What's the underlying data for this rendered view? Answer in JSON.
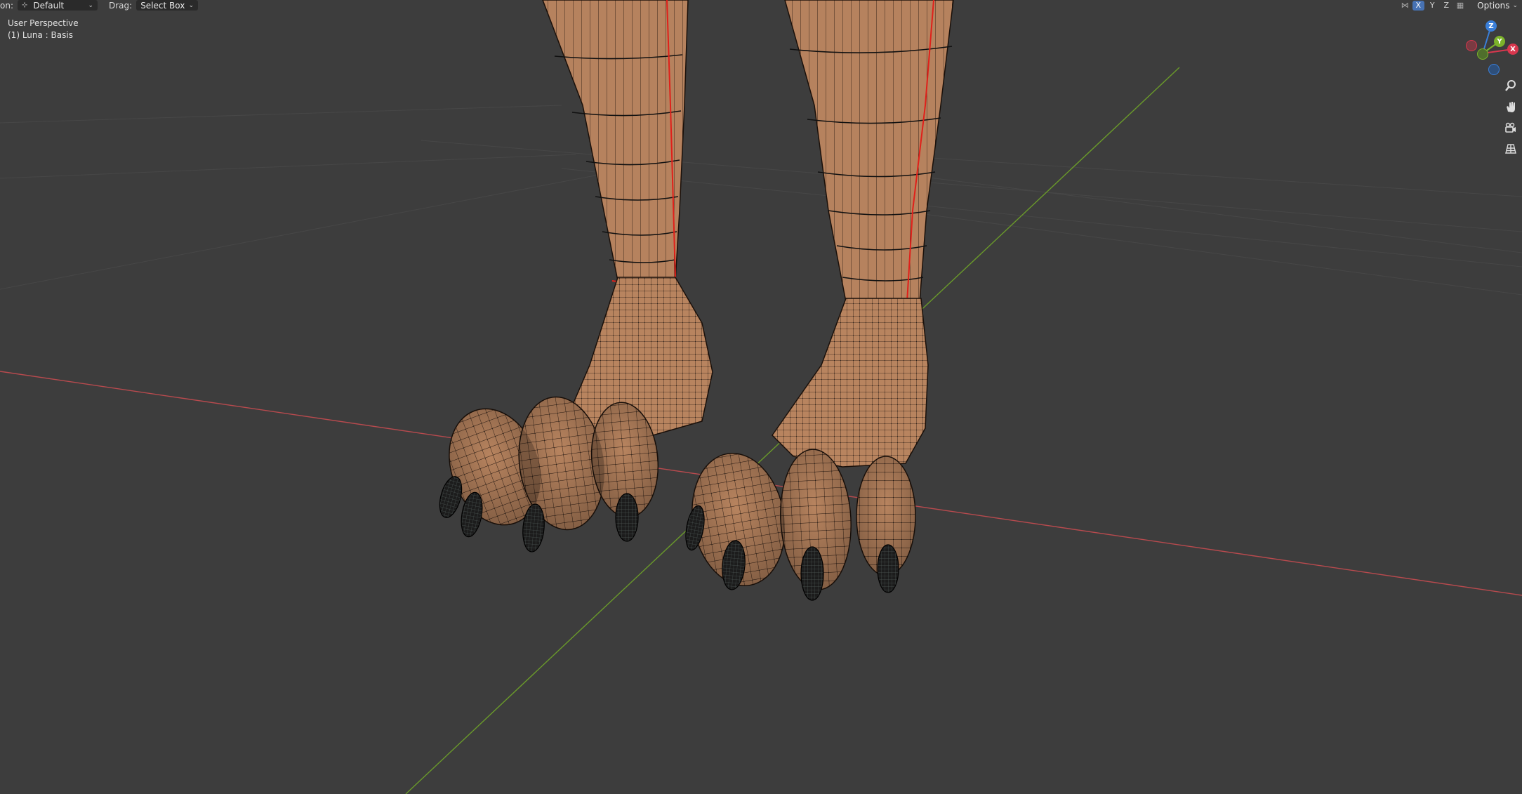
{
  "header": {
    "orientation_label": "on:",
    "orientation_value": "Default",
    "drag_label": "Drag:",
    "drag_value": "Select Box",
    "options_label": "Options"
  },
  "mirror_axes": {
    "x": "X",
    "y": "Y",
    "z": "Z",
    "active": "X"
  },
  "viewport_overlay": {
    "view_name": "User Perspective",
    "object_info": "(1) Luna : Basis"
  },
  "gizmo": {
    "z": "Z",
    "y": "Y",
    "x": "X"
  },
  "navigation": [
    "zoom-icon",
    "hand-pan-icon",
    "camera-icon",
    "grid-perspective-icon"
  ],
  "colors": {
    "viewport_bg": "#3d3d3d",
    "x_axis": "#b84a4e",
    "y_axis": "#6a9a2a",
    "mesh_skin": "#b6825e",
    "seam": "#e0201a",
    "claw": "#1c1c1c",
    "accent": "#4772b3"
  }
}
